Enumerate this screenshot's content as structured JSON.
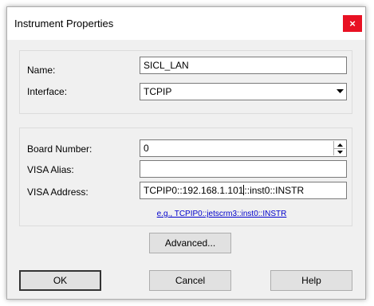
{
  "dialog": {
    "title": "Instrument Properties",
    "close_label": "×"
  },
  "fields": {
    "name_label": "Name:",
    "name_value": "SICL_LAN",
    "interface_label": "Interface:",
    "interface_value": "TCPIP",
    "board_number_label": "Board Number:",
    "board_number_value": "0",
    "visa_alias_label": "VISA Alias:",
    "visa_alias_value": "",
    "visa_address_label": "VISA Address:",
    "visa_address_before_caret": "TCPIP0::192.168.1.101",
    "visa_address_after_caret": "::inst0::INSTR",
    "example_text": "e.g., TCPIP0::jetscrm3::inst0::INSTR"
  },
  "buttons": {
    "advanced": "Advanced...",
    "ok": "OK",
    "cancel": "Cancel",
    "help": "Help"
  },
  "icons": {
    "close": "close-icon",
    "dropdown": "chevron-down-icon",
    "spin_up": "spin-up-icon",
    "spin_down": "spin-down-icon"
  }
}
